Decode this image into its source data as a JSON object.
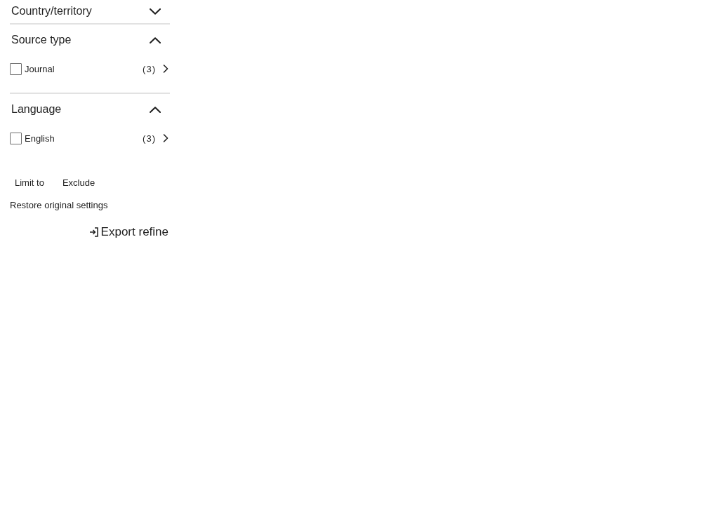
{
  "facets": [
    {
      "title": "Country/territory",
      "expanded": false
    },
    {
      "title": "Source type",
      "expanded": true,
      "items": [
        {
          "label": "Journal",
          "count": "(3)",
          "checked": false
        }
      ]
    },
    {
      "title": "Language",
      "expanded": true,
      "items": [
        {
          "label": "English",
          "count": "(3)",
          "checked": false
        }
      ]
    }
  ],
  "actions": [
    "Limit to",
    "Exclude"
  ],
  "restore_link": "Restore original settings",
  "export_button": "Export refine"
}
